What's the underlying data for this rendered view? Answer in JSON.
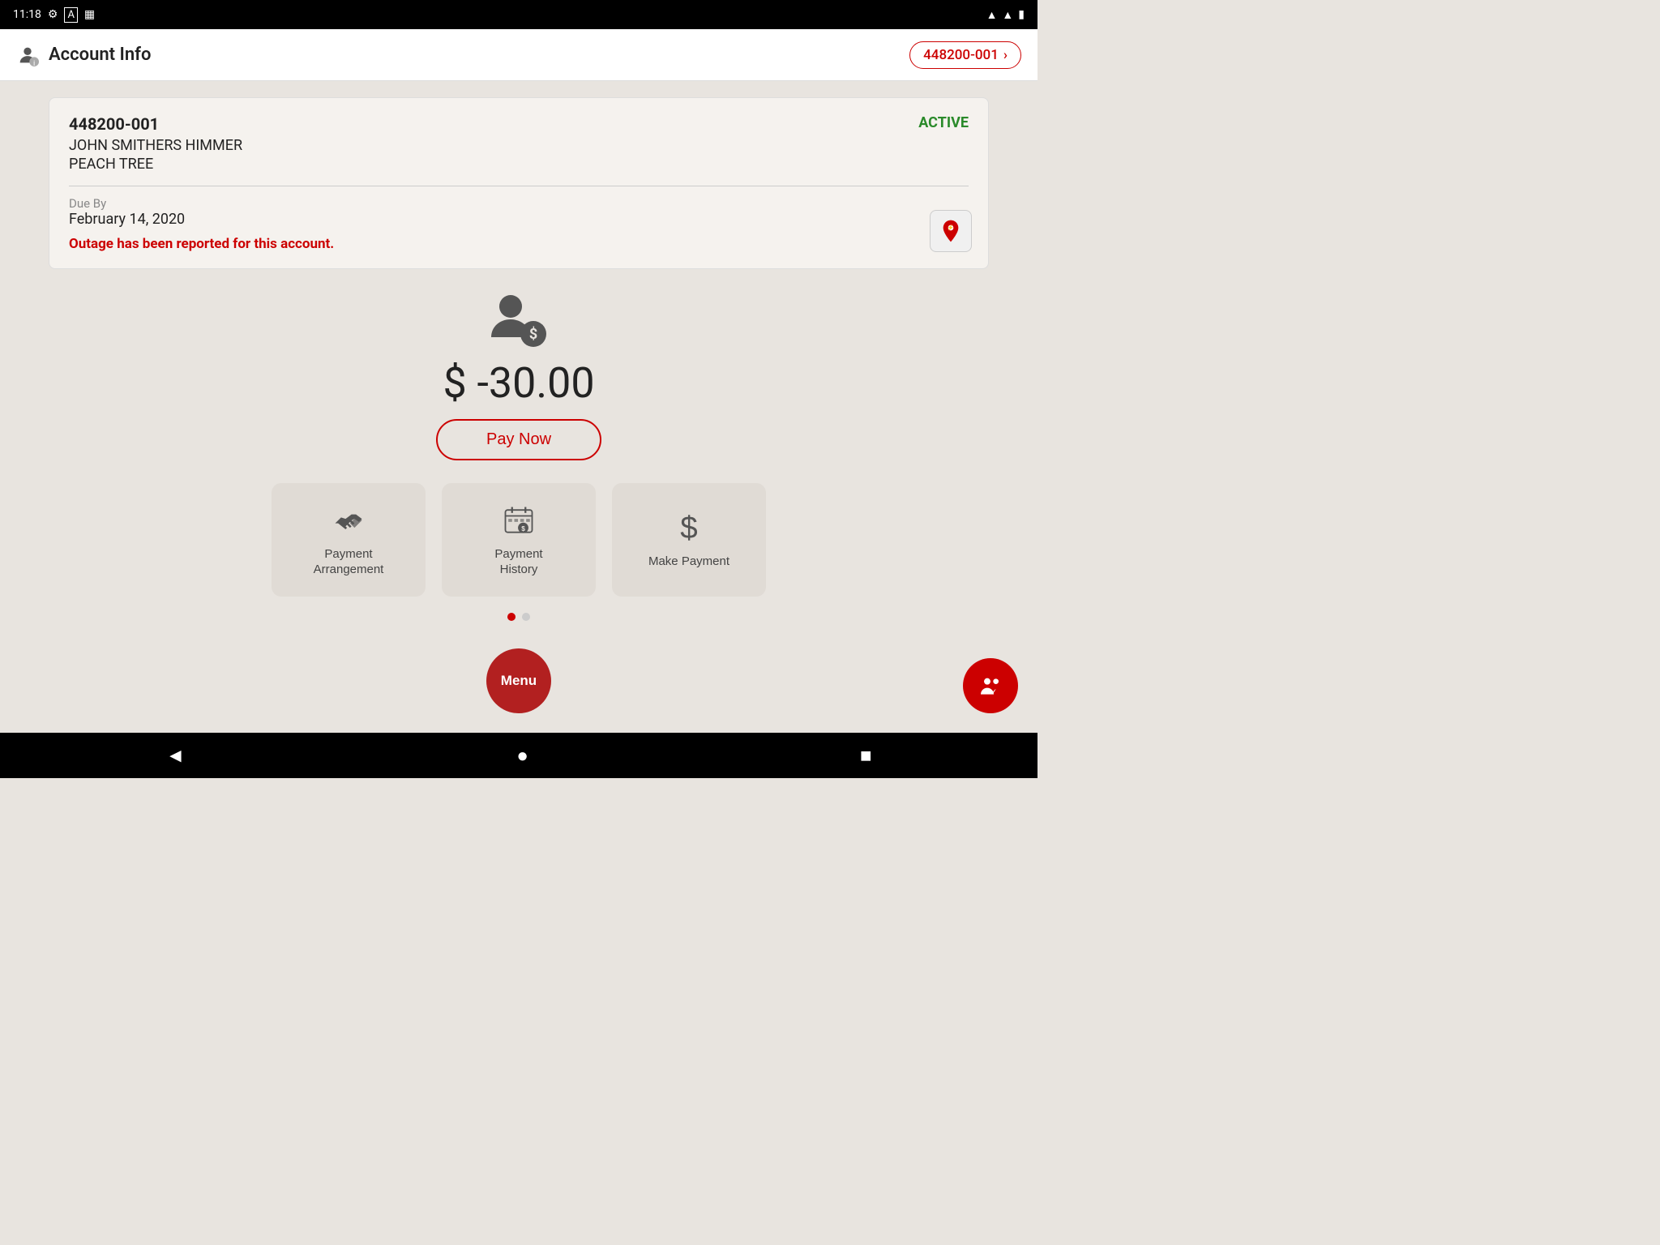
{
  "statusBar": {
    "time": "11:18",
    "icons": [
      "settings",
      "a-icon",
      "sim-icon"
    ]
  },
  "topBar": {
    "title": "Account Info",
    "accountNumber": "448200-001"
  },
  "accountCard": {
    "accountNumber": "448200-001",
    "status": "ACTIVE",
    "customerName": "JOHN SMITHERS HIMMER",
    "location": "PEACH TREE",
    "dueLabel": "Due By",
    "dueDate": "February 14, 2020",
    "outageMessage": "Outage has been reported for this account."
  },
  "balance": {
    "amount": "$ -30.00",
    "payNowLabel": "Pay Now"
  },
  "actionButtons": [
    {
      "id": "payment-arrangement",
      "label": "Payment\nArrangement",
      "iconType": "handshake"
    },
    {
      "id": "payment-history",
      "label": "Payment\nHistory",
      "iconType": "calendar-dollar"
    },
    {
      "id": "make-payment",
      "label": "Make Payment",
      "iconType": "dollar"
    }
  ],
  "dots": [
    {
      "active": true
    },
    {
      "active": false
    }
  ],
  "menuLabel": "Menu",
  "colors": {
    "accent": "#c00",
    "active": "#2a8a2a",
    "text": "#222"
  }
}
